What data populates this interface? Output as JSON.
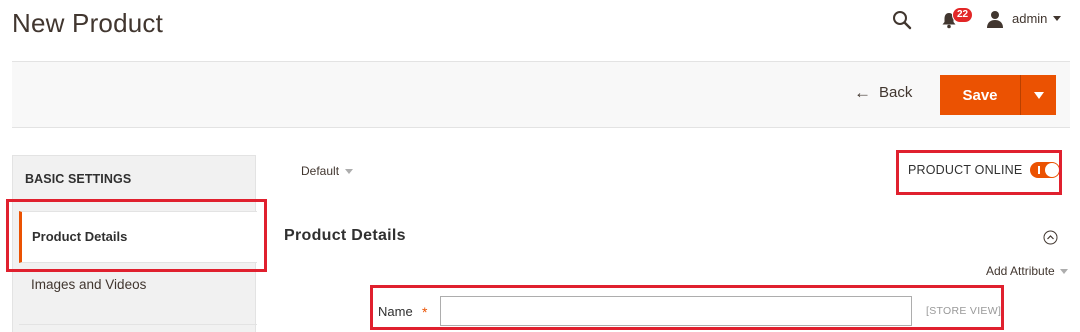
{
  "page": {
    "title": "New Product"
  },
  "header": {
    "notifications_count": "22",
    "user_name": "admin"
  },
  "action_bar": {
    "back_label": "Back",
    "save_label": "Save"
  },
  "sidebar": {
    "heading": "BASIC SETTINGS",
    "items": [
      {
        "label": "Product Details",
        "active": true
      },
      {
        "label": "Images and Videos",
        "active": false
      }
    ]
  },
  "form": {
    "scope": "Default",
    "product_online_label": "PRODUCT ONLINE",
    "product_online": true,
    "section_title": "Product Details",
    "add_attribute_label": "Add Attribute",
    "name_label": "Name",
    "name_required_mark": "*",
    "name_value": "",
    "name_scope_label": "[STORE VIEW]"
  },
  "colors": {
    "accent": "#eb5202",
    "highlight": "#e0202e",
    "badge": "#e22626"
  },
  "icons": [
    "search-icon",
    "bell-icon",
    "user-icon",
    "arrow-left-icon",
    "chevron-down-icon",
    "collapse-up-icon"
  ]
}
